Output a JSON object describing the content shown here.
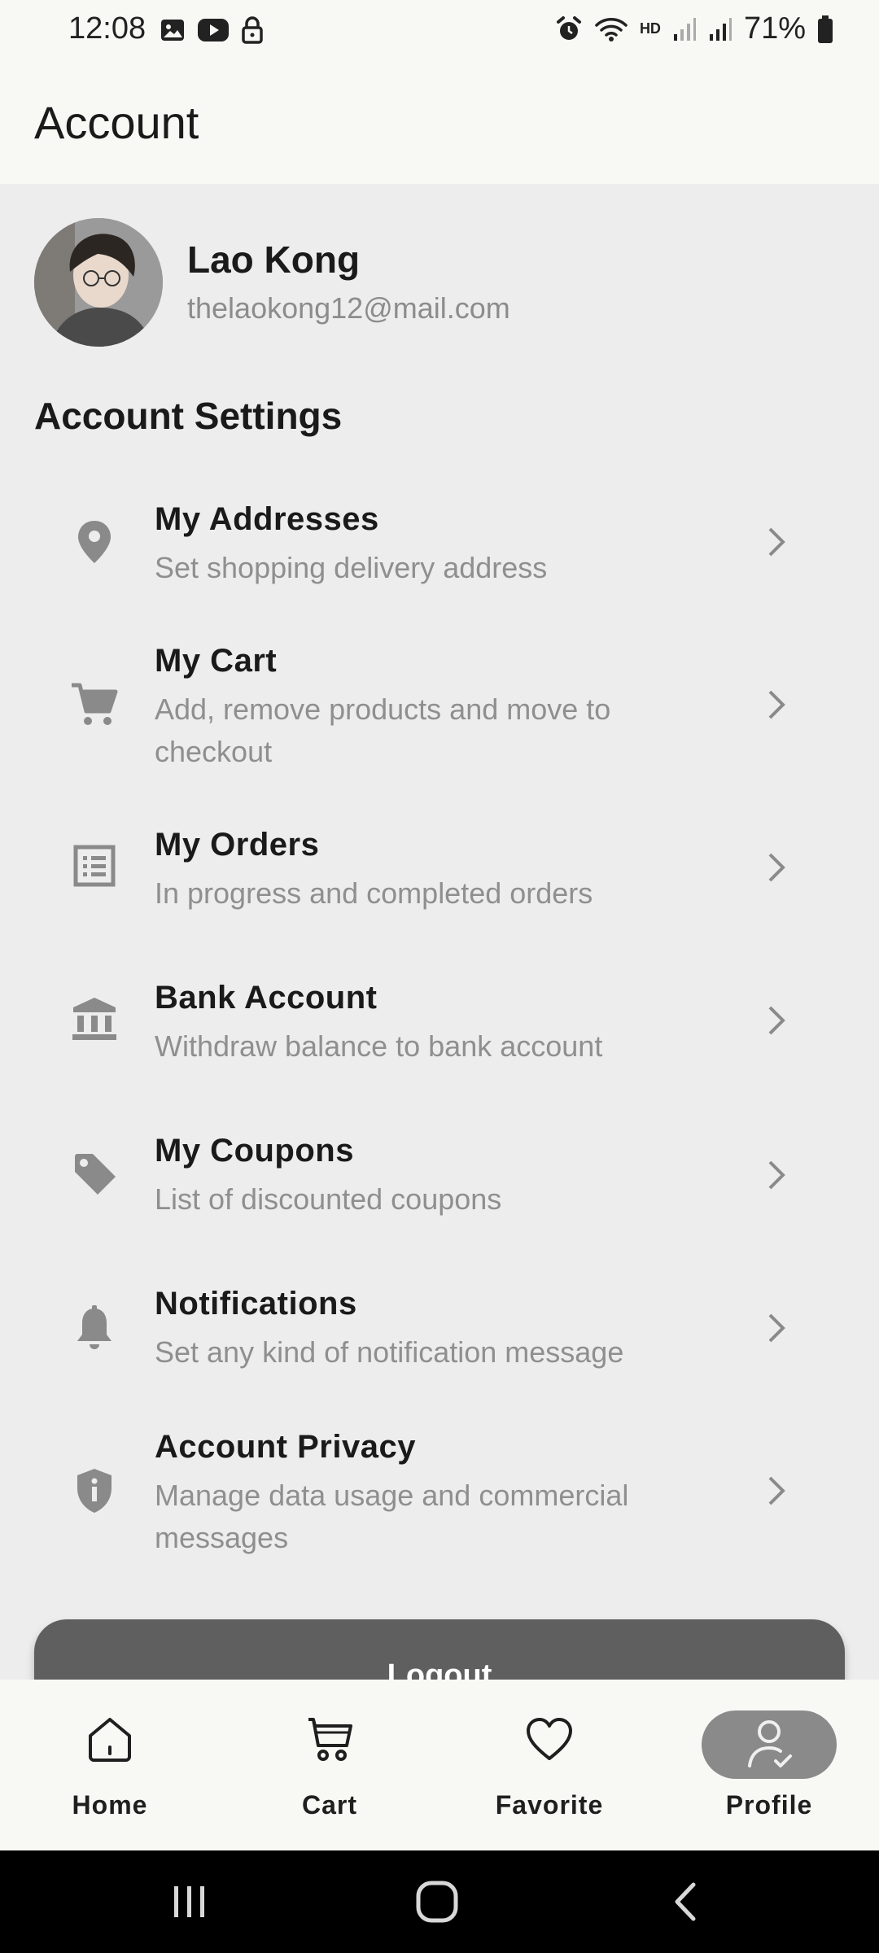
{
  "status_bar": {
    "time": "12:08",
    "battery": "71%",
    "icons": [
      "image-icon",
      "youtube-icon",
      "lock-icon",
      "alarm-icon",
      "wifi-icon",
      "hd-icon",
      "signal-icon",
      "signal-icon",
      "battery-icon"
    ],
    "hd_label": "HD"
  },
  "appbar": {
    "title": "Account"
  },
  "profile": {
    "name": "Lao Kong",
    "email": "thelaokong12@mail.com"
  },
  "settings": {
    "title": "Account Settings",
    "items": [
      {
        "icon": "location-pin-icon",
        "title": "My Addresses",
        "subtitle": "Set shopping delivery address"
      },
      {
        "icon": "cart-icon",
        "title": "My Cart",
        "subtitle": "Add, remove products and move to checkout"
      },
      {
        "icon": "list-icon",
        "title": "My Orders",
        "subtitle": "In progress and completed orders"
      },
      {
        "icon": "bank-icon",
        "title": "Bank Account",
        "subtitle": "Withdraw balance to bank account"
      },
      {
        "icon": "tag-icon",
        "title": "My Coupons",
        "subtitle": "List of discounted coupons"
      },
      {
        "icon": "bell-icon",
        "title": "Notifications",
        "subtitle": "Set any kind of notification message"
      },
      {
        "icon": "shield-icon",
        "title": "Account Privacy",
        "subtitle": "Manage data usage and commercial messages"
      }
    ]
  },
  "logout": {
    "label": "Logout"
  },
  "bottom_nav": {
    "items": [
      {
        "icon": "home-icon",
        "label": "Home"
      },
      {
        "icon": "cart-icon",
        "label": "Cart"
      },
      {
        "icon": "heart-icon",
        "label": "Favorite"
      },
      {
        "icon": "profile-icon",
        "label": "Profile",
        "selected": true
      }
    ]
  },
  "colors": {
    "background": "#ededed",
    "bar_background": "#f8f9f4",
    "icon_gray": "#8a8a8a",
    "logout_button": "#5f5f5f",
    "selected_pill": "#8a8a8a"
  }
}
